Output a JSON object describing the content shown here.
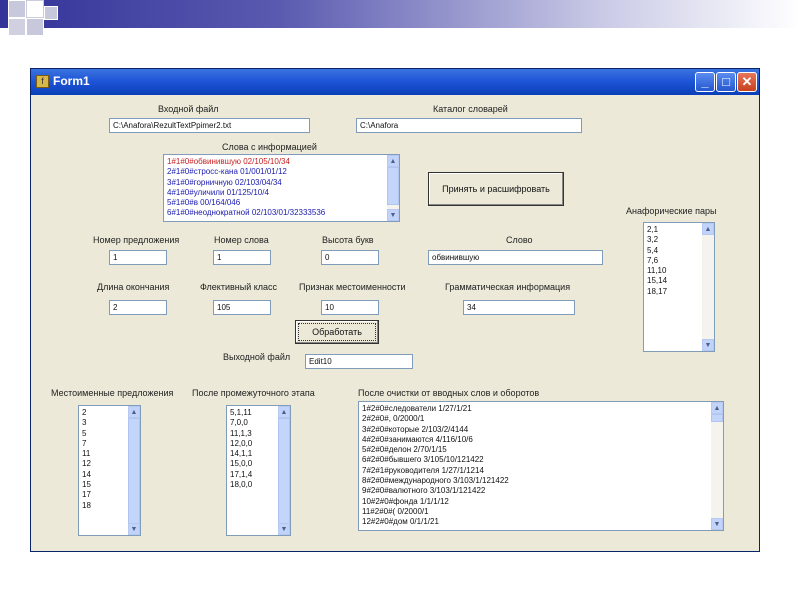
{
  "window": {
    "title": "Form1",
    "minimize": "_",
    "maximize": "□",
    "close": "✕"
  },
  "labels": {
    "input_file": "Входной файл",
    "dict_dir": "Каталог словарей",
    "words_info": "Слова с информацией",
    "anaphoric_pairs": "Анафорические пары",
    "sentence_no": "Номер предложения",
    "word_no": "Номер слова",
    "letter_height": "Высота букв",
    "word": "Слово",
    "ending_len": "Длина окончания",
    "flex_class": "Флективный класс",
    "pronoun_sign": "Признак местоименности",
    "gram_info": "Грамматическая информация",
    "output_file": "Выходной файл",
    "pronoun_sentences": "Местоименные предложения",
    "after_intermediate": "После промежуточного этапа",
    "after_cleanup": "После очистки от вводных слов и оборотов"
  },
  "fields": {
    "input_file": "C:\\Anafora\\RezultTextPpimer2.txt",
    "dict_dir": "C:\\Anafora",
    "sentence_no": "1",
    "word_no": "1",
    "letter_height": "0",
    "word": "обвинившую",
    "ending_len": "2",
    "flex_class": "105",
    "pronoun_sign": "10",
    "gram_info": "34",
    "output_file": "Edit10"
  },
  "buttons": {
    "accept": "Принять и расшифровать",
    "process": "Обработать"
  },
  "lists": {
    "words_info": [
      {
        "text": "1#1#0#обвинившую 02/105/10/34",
        "color": "#c82020"
      },
      {
        "text": "2#1#0#стросс-кана 01/001/01/12",
        "color": "#1a1ab0"
      },
      {
        "text": "3#1#0#горничную 02/103/04/34",
        "color": "#1a1ab0"
      },
      {
        "text": "4#1#0#уличили 01/125/10/4",
        "color": "#1a1ab0"
      },
      {
        "text": "5#1#0#в 00/164/046",
        "color": "#1a1ab0"
      },
      {
        "text": "6#1#0#неоднократной 02/103/01/32333536",
        "color": "#1a1ab0"
      }
    ],
    "anaphoric_pairs": [
      "2,1",
      "3,2",
      "5,4",
      "7,6",
      "11,10",
      "15,14",
      "18,17"
    ],
    "pronoun_sentences": [
      "2",
      "3",
      "5",
      "7",
      "11",
      "12",
      "14",
      "15",
      "17",
      "18"
    ],
    "after_intermediate": [
      "5,1,11",
      "7,0,0",
      "11,1,3",
      "12,0,0",
      "14,1,1",
      "15,0,0",
      "17,1,4",
      "18,0,0"
    ],
    "after_cleanup": [
      "1#2#0#следователи 1/27/1/21",
      "2#2#0#, 0/2000/1",
      "3#2#0#которые 2/103/2/4144",
      "4#2#0#занимаются 4/116/10/6",
      "5#2#0#делон 2/70/1/15",
      "6#2#0#бывшего 3/105/10/121422",
      "7#2#1#руководителя 1/27/1/1214",
      "8#2#0#международного 3/103/1/121422",
      "9#2#0#валютного 3/103/1/121422",
      "10#2#0#фонда 1/1/1/12",
      "11#2#0#( 0/2000/1",
      "12#2#0#дом 0/1/1/21"
    ]
  },
  "colors": {
    "titlebar": "#1f56d8",
    "form_bg": "#ece9d8",
    "list_border": "#7f9db9",
    "highlight_red": "#c82020",
    "list_blue": "#1a1ab0"
  },
  "scroll_arrows": {
    "up": "▲",
    "down": "▼"
  }
}
